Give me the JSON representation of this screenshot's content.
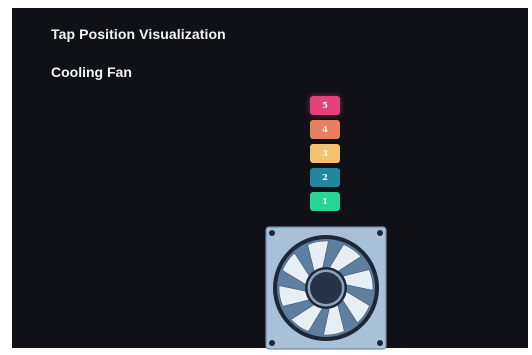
{
  "header": {
    "title": "Tap Position Visualization",
    "subtitle": "Cooling Fan"
  },
  "tap_positions": [
    {
      "label": "5",
      "color": "#e3427a",
      "active": true
    },
    {
      "label": "4",
      "color": "#e87f61"
    },
    {
      "label": "3",
      "color": "#f5c16c"
    },
    {
      "label": "2",
      "color": "#22879c"
    },
    {
      "label": "1",
      "color": "#25d694"
    }
  ],
  "fan": {
    "icon": "cooling-fan-icon",
    "frame_color": "#a9c1d8",
    "blade_color": "#e7eef4",
    "hub_color": "#263445"
  },
  "colors": {
    "background": "#0f1116",
    "text": "#f4f4f6"
  }
}
